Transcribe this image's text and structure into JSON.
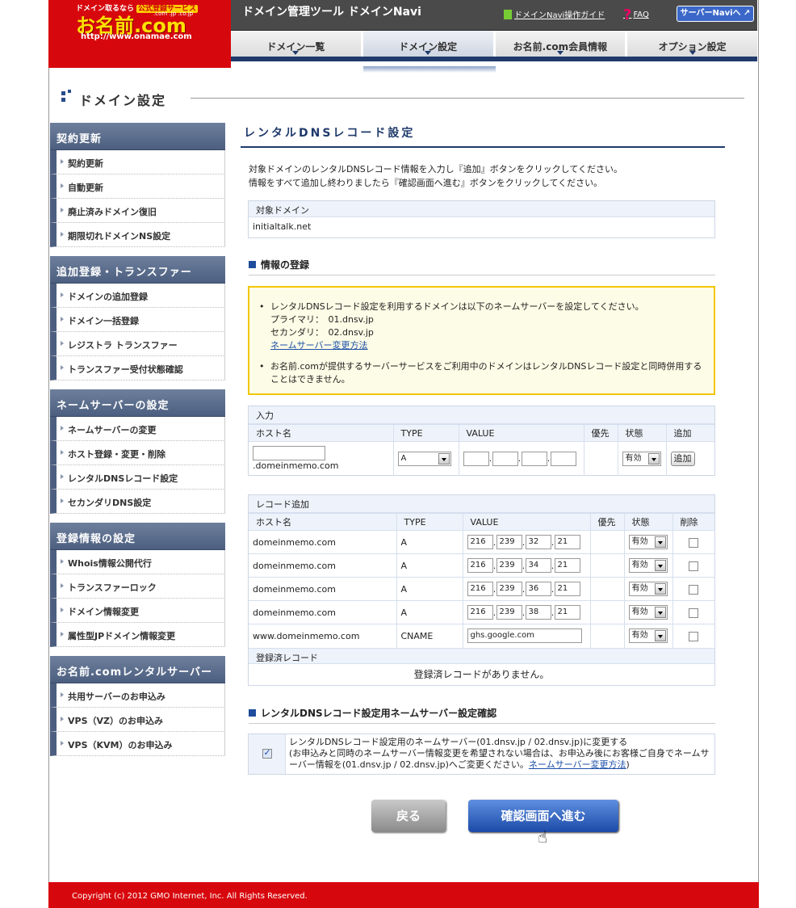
{
  "logo": {
    "tagline": "ドメイン取るなら",
    "badge": "公式登録サービス",
    "tlds": ".com .jp .co.jp",
    "brand": "お名前.com",
    "url": "http://www.onamae.com"
  },
  "header": {
    "title": "ドメイン管理ツール ドメインNavi",
    "guide_label": "ドメインNavi操作ガイド",
    "faq_label": "FAQ",
    "server_navi_label": "サーバーNaviへ ↗"
  },
  "tabs": [
    {
      "label": "ドメイン一覧"
    },
    {
      "label": "ドメイン設定"
    },
    {
      "label": "お名前.com会員情報"
    },
    {
      "label": "オプション設定"
    }
  ],
  "page_title": "ドメイン設定",
  "sidebar": {
    "groups": [
      {
        "title": "契約更新",
        "items": [
          "契約更新",
          "自動更新",
          "廃止済みドメイン復旧",
          "期限切れドメインNS設定"
        ]
      },
      {
        "title": "追加登録・トランスファー",
        "items": [
          "ドメインの追加登録",
          "ドメイン一括登録",
          "レジストラ トランスファー",
          "トランスファー受付状態確認"
        ]
      },
      {
        "title": "ネームサーバーの設定",
        "items": [
          "ネームサーバーの変更",
          "ホスト登録・変更・削除",
          "レンタルDNSレコード設定",
          "セカンダリDNS設定"
        ]
      },
      {
        "title": "登録情報の設定",
        "items": [
          "Whois情報公開代行",
          "トランスファーロック",
          "ドメイン情報変更",
          "属性型JPドメイン情報変更"
        ]
      },
      {
        "title": "お名前.comレンタルサーバー",
        "items": [
          "共用サーバーのお申込み",
          "VPS（VZ）のお申込み",
          "VPS（KVM）のお申込み"
        ]
      }
    ]
  },
  "content": {
    "title": "レンタルDNSレコード設定",
    "intro_line1": "対象ドメインのレンタルDNSレコード情報を入力し『追加』ボタンをクリックしてください。",
    "intro_line2": "情報をすべて追加し終わりましたら『確認画面へ進む』ボタンをクリックしてください。",
    "target_label": "対象ドメイン",
    "target_domain": "initialtalk.net",
    "register_heading": "情報の登録",
    "notice": {
      "item1_line1": "レンタルDNSレコード設定を利用するドメインは以下のネームサーバーを設定してください。",
      "primary": "プライマリ：　01.dnsv.jp",
      "secondary": "セカンダリ：　02.dnsv.jp",
      "ns_link": "ネームサーバー変更方法",
      "item2": "お名前.comが提供するサーバーサービスをご利用中のドメインはレンタルDNSレコード設定と同時併用することはできません。"
    },
    "input": {
      "label": "入力",
      "headers": [
        "ホスト名",
        "TYPE",
        "VALUE",
        "優先",
        "状態",
        "追加"
      ],
      "host_suffix": ".domeinmemo.com",
      "type": "A",
      "state": "有効",
      "add_button": "追加"
    },
    "records": {
      "label": "レコード追加",
      "headers": [
        "ホスト名",
        "TYPE",
        "VALUE",
        "優先",
        "状態",
        "削除"
      ],
      "rows": [
        {
          "host": "domeinmemo.com",
          "type": "A",
          "ip": [
            "216",
            "239",
            "32",
            "21"
          ],
          "state": "有効"
        },
        {
          "host": "domeinmemo.com",
          "type": "A",
          "ip": [
            "216",
            "239",
            "34",
            "21"
          ],
          "state": "有効"
        },
        {
          "host": "domeinmemo.com",
          "type": "A",
          "ip": [
            "216",
            "239",
            "36",
            "21"
          ],
          "state": "有効"
        },
        {
          "host": "domeinmemo.com",
          "type": "A",
          "ip": [
            "216",
            "239",
            "38",
            "21"
          ],
          "state": "有効"
        },
        {
          "host": "www.domeinmemo.com",
          "type": "CNAME",
          "value": "ghs.google.com",
          "state": "有効"
        }
      ],
      "registered_label": "登録済レコード",
      "registered_empty": "登録済レコードがありません。"
    },
    "confirm_heading": "レンタルDNSレコード設定用ネームサーバー設定確認",
    "confirm_text_1": "レンタルDNSレコード設定用のネームサーバー(01.dnsv.jp / 02.dnsv.jp)に変更する",
    "confirm_text_2": "(お申込みと同時のネームサーバー情報変更を希望されない場合は、お申込み後にお客様ご自身でネームサーバー情報を(01.dnsv.jp / 02.dnsv.jp)へご変更ください。",
    "confirm_link": "ネームサーバー変更方法",
    "confirm_close": ")",
    "back_button": "戻る",
    "next_button": "確認画面へ進む"
  },
  "footer": "Copyright (c) 2012 GMO Internet, Inc. All Rights Reserved."
}
